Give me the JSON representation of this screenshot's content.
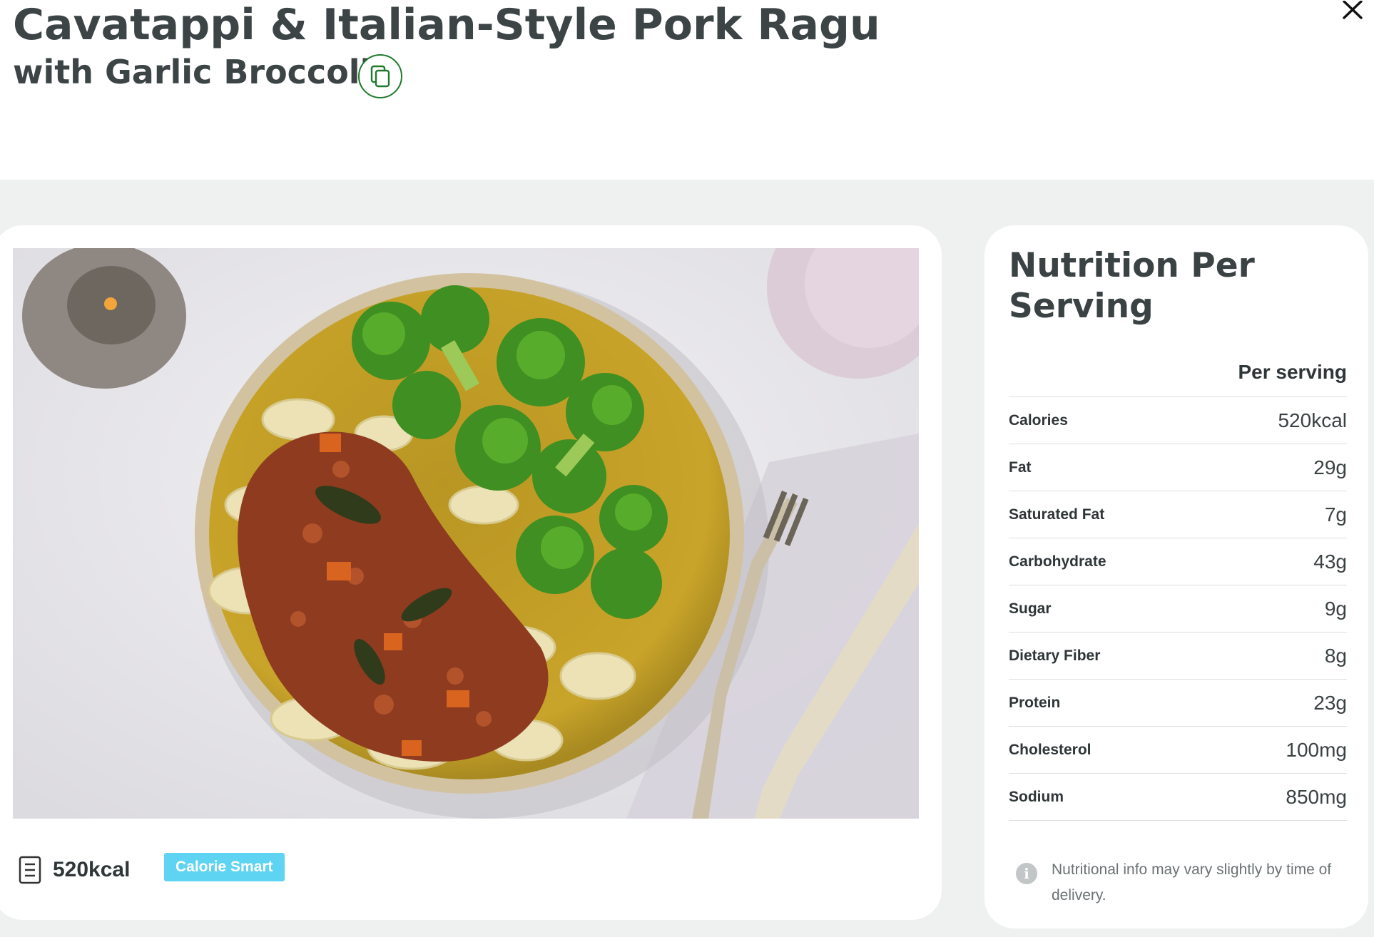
{
  "recipe": {
    "title_line1": "Cavatappi & Italian-Style Pork Ragu",
    "title_line2": "with Garlic Broccoli"
  },
  "icons": {
    "copy": "copy-icon",
    "close": "close-icon",
    "calories": "document-icon",
    "info": "info-icon"
  },
  "card": {
    "calories": "520kcal",
    "badge": "Calorie Smart",
    "badge_color": "#5fd3f2"
  },
  "nutrition": {
    "title": "Nutrition Per Serving",
    "column_header": "Per serving",
    "rows": [
      {
        "name": "Calories",
        "value": "520kcal"
      },
      {
        "name": "Fat",
        "value": "29g"
      },
      {
        "name": "Saturated Fat",
        "value": "7g"
      },
      {
        "name": "Carbohydrate",
        "value": "43g"
      },
      {
        "name": "Sugar",
        "value": "9g"
      },
      {
        "name": "Dietary Fiber",
        "value": "8g"
      },
      {
        "name": "Protein",
        "value": "23g"
      },
      {
        "name": "Cholesterol",
        "value": "100mg"
      },
      {
        "name": "Sodium",
        "value": "850mg"
      }
    ],
    "note": "Nutritional info may vary slightly by time of delivery."
  },
  "colors": {
    "accent_green": "#1f7a2e",
    "background": "#eff1f0"
  }
}
